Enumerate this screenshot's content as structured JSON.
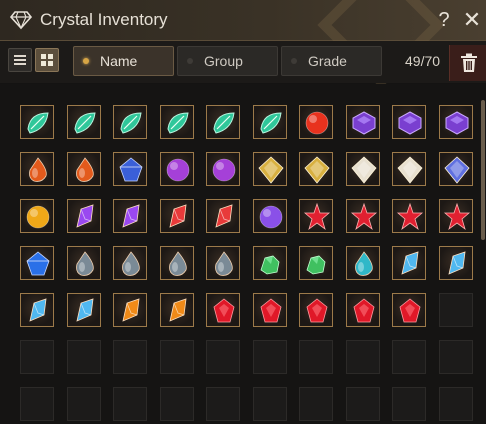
{
  "window": {
    "title": "Crystal Inventory"
  },
  "controls": {
    "help": "?",
    "close": "✕"
  },
  "toolbar": {
    "sort_options": [
      {
        "label": "Name",
        "active": true
      },
      {
        "label": "Group",
        "active": false
      },
      {
        "label": "Grade",
        "active": false
      }
    ],
    "count": "49/70"
  },
  "colors": {
    "accent": "#d7a545",
    "slot_border": "#9c7a4a",
    "trash_bg": "#3a1e1a"
  },
  "inventory": {
    "columns": 10,
    "rows_visible": 7,
    "items": [
      {
        "type": "green-leaf-crystal",
        "color": "#2fc79a"
      },
      {
        "type": "green-leaf-crystal",
        "color": "#2fc79a"
      },
      {
        "type": "green-leaf-crystal",
        "color": "#2fc79a"
      },
      {
        "type": "green-leaf-crystal",
        "color": "#2fc79a"
      },
      {
        "type": "green-leaf-crystal",
        "color": "#2fc79a"
      },
      {
        "type": "green-leaf-crystal",
        "color": "#2fc79a"
      },
      {
        "type": "red-orb-crystal",
        "color": "#e8321e"
      },
      {
        "type": "purple-hex-crystal",
        "color": "#7a3fd0"
      },
      {
        "type": "purple-hex-crystal",
        "color": "#7a3fd0"
      },
      {
        "type": "purple-hex-crystal",
        "color": "#7a3fd0"
      },
      {
        "type": "orange-drop-crystal",
        "color": "#e35a1c"
      },
      {
        "type": "orange-drop-crystal",
        "color": "#e35a1c"
      },
      {
        "type": "blue-cut-crystal",
        "color": "#3a5fd8"
      },
      {
        "type": "violet-round-crystal",
        "color": "#a540d8"
      },
      {
        "type": "violet-round-crystal",
        "color": "#a540d8"
      },
      {
        "type": "gold-diamond-crystal",
        "color": "#d8b040"
      },
      {
        "type": "gold-diamond-crystal",
        "color": "#d8b040"
      },
      {
        "type": "white-diamond-crystal",
        "color": "#e8e0d0"
      },
      {
        "type": "white-diamond-crystal",
        "color": "#e8e0d0"
      },
      {
        "type": "blue-diamond-crystal",
        "color": "#6070e0"
      },
      {
        "type": "gold-orb-crystal",
        "color": "#f0a818"
      },
      {
        "type": "violet-shard-crystal",
        "color": "#9a48f0"
      },
      {
        "type": "violet-shard-crystal",
        "color": "#9a48f0"
      },
      {
        "type": "red-shard-crystal",
        "color": "#e83a3a"
      },
      {
        "type": "red-shard-crystal",
        "color": "#e83a3a"
      },
      {
        "type": "violet-orb-crystal",
        "color": "#8a50e8"
      },
      {
        "type": "red-star-crystal",
        "color": "#e02030"
      },
      {
        "type": "red-star-crystal",
        "color": "#e02030"
      },
      {
        "type": "red-star-crystal",
        "color": "#e02030"
      },
      {
        "type": "red-star-crystal",
        "color": "#e02030"
      },
      {
        "type": "blue-cut-crystal",
        "color": "#2a70e8"
      },
      {
        "type": "dark-drop-crystal",
        "color": "#7a8a96"
      },
      {
        "type": "dark-drop-crystal",
        "color": "#7a8a96"
      },
      {
        "type": "dark-drop-crystal",
        "color": "#7a8a96"
      },
      {
        "type": "dark-drop-crystal",
        "color": "#7a8a96"
      },
      {
        "type": "green-cluster-crystal",
        "color": "#40c060"
      },
      {
        "type": "green-cluster-crystal",
        "color": "#40c060"
      },
      {
        "type": "teal-drop-crystal",
        "color": "#30b8c8"
      },
      {
        "type": "lightning-shard-crystal",
        "color": "#50b8f0"
      },
      {
        "type": "lightning-shard-crystal",
        "color": "#50b8f0"
      },
      {
        "type": "lightning-shard-crystal",
        "color": "#50b8f0"
      },
      {
        "type": "lightning-shard-crystal",
        "color": "#50b8f0"
      },
      {
        "type": "fire-shard-crystal",
        "color": "#f08a18"
      },
      {
        "type": "fire-shard-crystal",
        "color": "#f08a18"
      },
      {
        "type": "red-gem-crystal",
        "color": "#e01828"
      },
      {
        "type": "red-gem-crystal",
        "color": "#e01828"
      },
      {
        "type": "red-gem-crystal",
        "color": "#e01828"
      },
      {
        "type": "red-gem-crystal",
        "color": "#e01828"
      },
      {
        "type": "red-gem-crystal",
        "color": "#e01828"
      }
    ]
  }
}
